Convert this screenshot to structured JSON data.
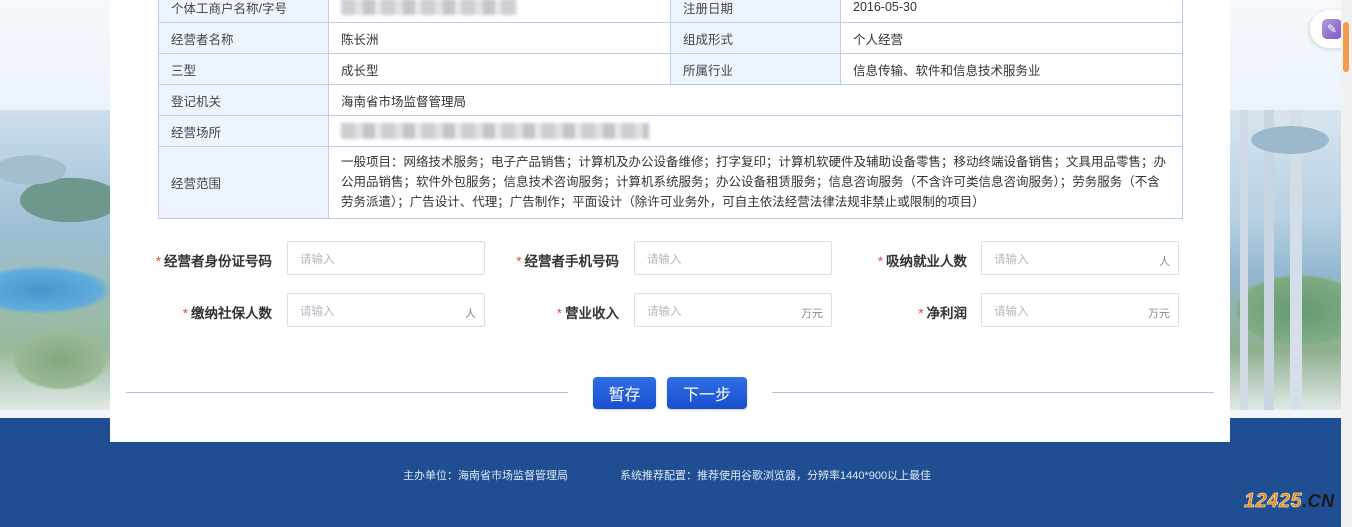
{
  "info_table": {
    "rows": [
      {
        "label1": "个体工商户名称/字号",
        "value1": "",
        "label2": "注册日期",
        "value2": "2016-05-30"
      },
      {
        "label1": "经营者名称",
        "value1": "陈长洲",
        "label2": "组成形式",
        "value2": "个人经营"
      },
      {
        "label1": "三型",
        "value1": "成长型",
        "label2": "所属行业",
        "value2": "信息传输、软件和信息技术服务业"
      }
    ],
    "registration_authority_label": "登记机关",
    "registration_authority_value": "海南省市场监督管理局",
    "business_place_label": "经营场所",
    "business_scope_label": "经营范围",
    "business_scope_value": "一般项目：网络技术服务；电子产品销售；计算机及办公设备维修；打字复印；计算机软硬件及辅助设备零售；移动终端设备销售；文具用品零售；办公用品销售；软件外包服务；信息技术咨询服务；计算机系统服务；办公设备租赁服务；信息咨询服务（不含许可类信息咨询服务）；劳务服务（不含劳务派遣）；广告设计、代理；广告制作；平面设计（除许可业务外，可自主依法经营法律法规非禁止或限制的项目）"
  },
  "form": {
    "required_mark": "*",
    "placeholder": "请输入",
    "fields": [
      {
        "label": "经营者身份证号码",
        "unit": ""
      },
      {
        "label": "经营者手机号码",
        "unit": ""
      },
      {
        "label": "吸纳就业人数",
        "unit": "人"
      },
      {
        "label": "缴纳社保人数",
        "unit": "人"
      },
      {
        "label": "营业收入",
        "unit": "万元"
      },
      {
        "label": "净利润",
        "unit": "万元"
      }
    ]
  },
  "buttons": {
    "save": "暂存",
    "next": "下一步"
  },
  "footer": {
    "sponsor": "主办单位：海南省市场监督管理局",
    "recommend": "系统推荐配置：推荐使用谷歌浏览器，分辨率1440*900以上最佳"
  },
  "watermark": {
    "numbers": "12425",
    "suffix": ".CN"
  },
  "colors": {
    "footer_bg": "#1f4e93",
    "button_bg": "#1a4fcf",
    "required": "#e74c3c",
    "table_border": "#b9cdf0",
    "label_bg": "#eef4fd"
  }
}
